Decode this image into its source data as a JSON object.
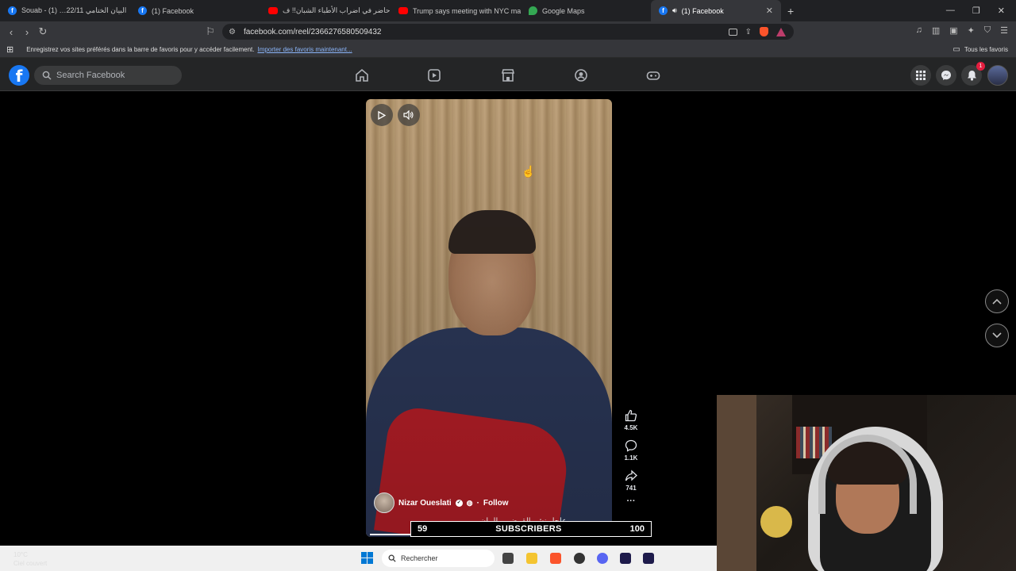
{
  "browser": {
    "tabs": [
      {
        "label": "Souab - البيان الختامي 22/11… (1)",
        "icon": "facebook-icon"
      },
      {
        "label": "(1) Facebook",
        "icon": "facebook-icon"
      },
      {
        "label": "كنت حاضر في اضراب الأطباء الشبان!! ف…",
        "icon": "youtube-icon"
      },
      {
        "label": "Trump says meeting with NYC mayor",
        "icon": "youtube-icon"
      },
      {
        "label": "Google Maps",
        "icon": "google-maps-icon"
      },
      {
        "label": "(1) Facebook",
        "icon": "facebook-icon",
        "active": true
      }
    ],
    "url": "facebook.com/reel/2366276580509432",
    "bookmarks_bar": {
      "message": "Enregistrez vos sites préférés dans la barre de favoris pour y accéder facilement.",
      "link": "Importer des favoris maintenant...",
      "all_favorites": "Tous les favoris"
    }
  },
  "facebook": {
    "search_placeholder": "Search Facebook",
    "notification_count": "1",
    "nav_icons": [
      "home-icon",
      "reels-icon",
      "marketplace-icon",
      "groups-icon",
      "gaming-icon"
    ]
  },
  "reel": {
    "author": "Nizar Oueslati",
    "follow": "Follow",
    "separator": "·",
    "caption": "عاجل نشر القرض… البيان…",
    "likes": "4.5K",
    "comments": "1.1K",
    "shares": "741",
    "more": "···"
  },
  "overlay": {
    "subscribers_current": "59",
    "subscribers_label": "SUBSCRIBERS",
    "subscribers_goal": "100"
  },
  "taskbar": {
    "weather_temp": "10°C",
    "weather_desc": "Ciel couvert",
    "search_placeholder": "Rechercher"
  },
  "colors": {
    "facebook_blue": "#1877f2",
    "header_bg": "#242526",
    "notification_red": "#e41e3f"
  }
}
